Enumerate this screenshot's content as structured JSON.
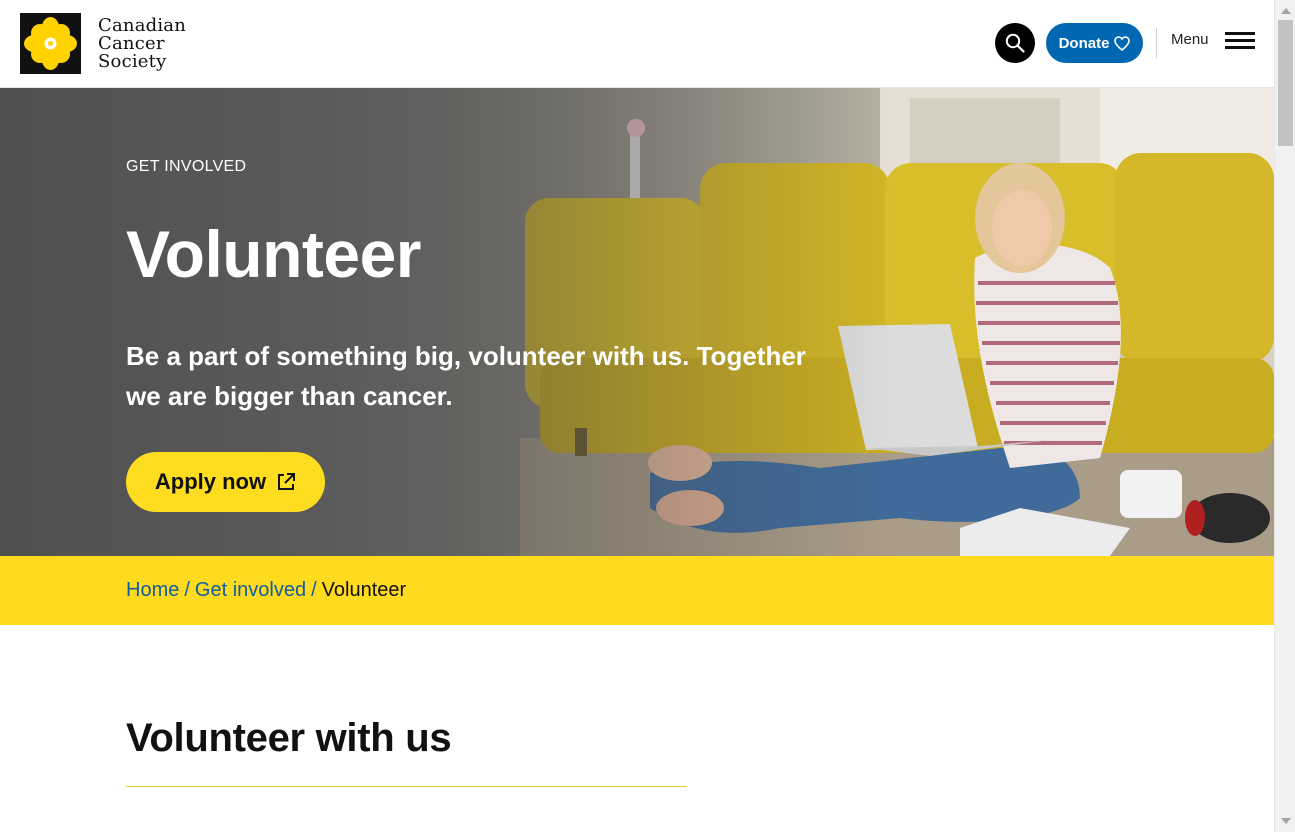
{
  "header": {
    "logo_lines": [
      "Canadian",
      "Cancer",
      "Society"
    ],
    "donate_label": "Donate",
    "menu_label": "Menu"
  },
  "hero": {
    "eyebrow": "GET INVOLVED",
    "title": "Volunteer",
    "subtitle": "Be a part of something big, volunteer with us. Together we are bigger than cancer.",
    "apply_label": "Apply now"
  },
  "breadcrumb": {
    "items": [
      "Home",
      "Get involved"
    ],
    "separator": "/",
    "current": "Volunteer"
  },
  "main": {
    "section_title": "Volunteer with us"
  },
  "colors": {
    "brand_yellow": "#fedb1f",
    "donate_blue": "#0067b3",
    "link_blue": "#125ca0"
  }
}
